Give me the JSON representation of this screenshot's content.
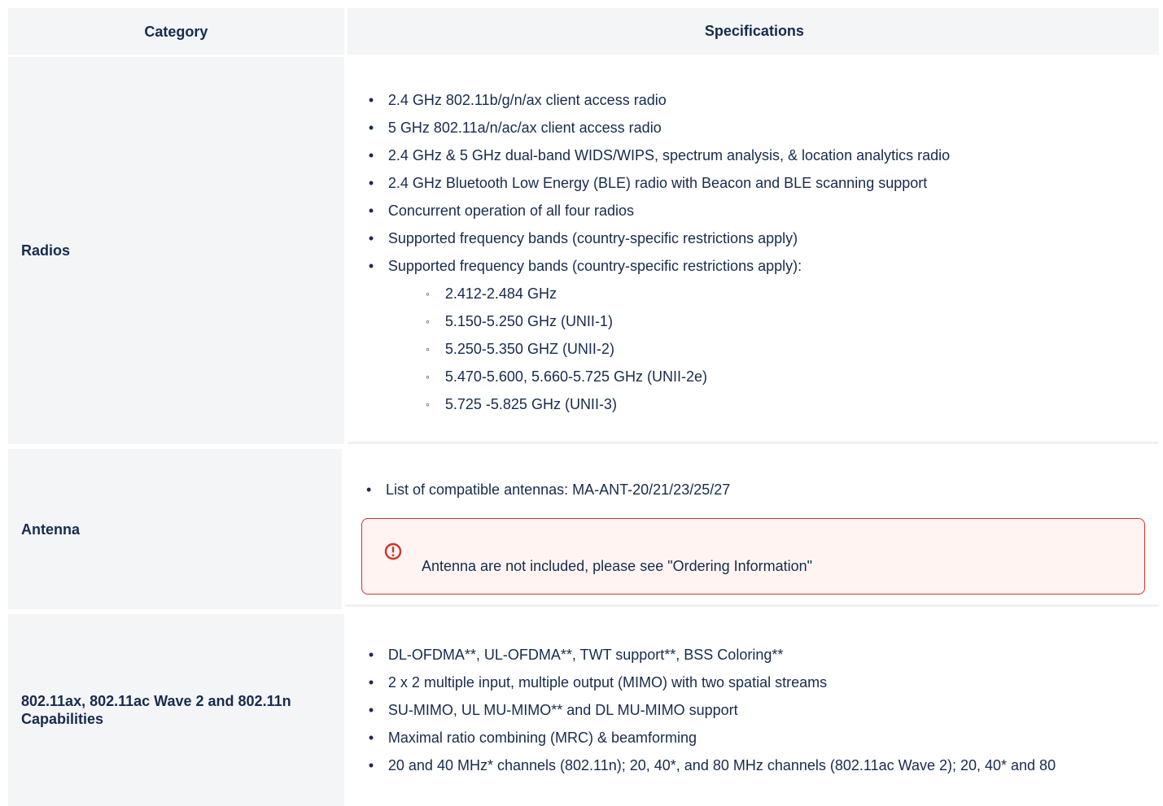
{
  "header": {
    "category": "Category",
    "specifications": "Specifications"
  },
  "rows": [
    {
      "category": "Radios",
      "items": [
        "2.4 GHz 802.11b/g/n/ax client access radio",
        "5 GHz 802.11a/n/ac/ax client access radio",
        "2.4 GHz & 5 GHz dual-band WIDS/WIPS, spectrum analysis, & location analytics radio",
        "2.4 GHz Bluetooth Low Energy (BLE) radio with Beacon and BLE scanning support",
        "Concurrent operation of all four radios",
        "Supported frequency bands (country-specific restrictions apply)",
        "Supported frequency bands (country-specific restrictions apply):"
      ],
      "subitems": [
        "2.412-2.484 GHz",
        "5.150-5.250 GHz (UNII-1)",
        "5.250-5.350 GHZ (UNII-2)",
        "5.470-5.600, 5.660-5.725 GHz (UNII-2e)",
        "5.725 -5.825 GHz (UNII-3)"
      ]
    },
    {
      "category": "Antenna",
      "items": [
        "List of compatible antennas: MA-ANT-20/21/23/25/27"
      ],
      "notice": {
        "icon": "warning-circle-icon",
        "text": "Antenna are not included, please see \"Ordering Information\""
      }
    },
    {
      "category": "802.11ax, 802.11ac Wave 2 and 802.11n Capabilities",
      "items": [
        "DL-OFDMA**, UL-OFDMA**, TWT support**, BSS Coloring**",
        "2 x 2 multiple input, multiple output (MIMO) with two spatial streams",
        "SU-MIMO, UL MU-MIMO** and DL MU-MIMO support",
        "Maximal ratio combining (MRC) & beamforming",
        "20 and 40 MHz* channels (802.11n); 20, 40*, and 80 MHz channels (802.11ac Wave 2); 20, 40* and 80"
      ]
    }
  ],
  "colors": {
    "header_bg": "#f4f5f7",
    "text": "#172b4d",
    "notice_border": "#c9372c",
    "notice_bg": "#fff4f2"
  }
}
